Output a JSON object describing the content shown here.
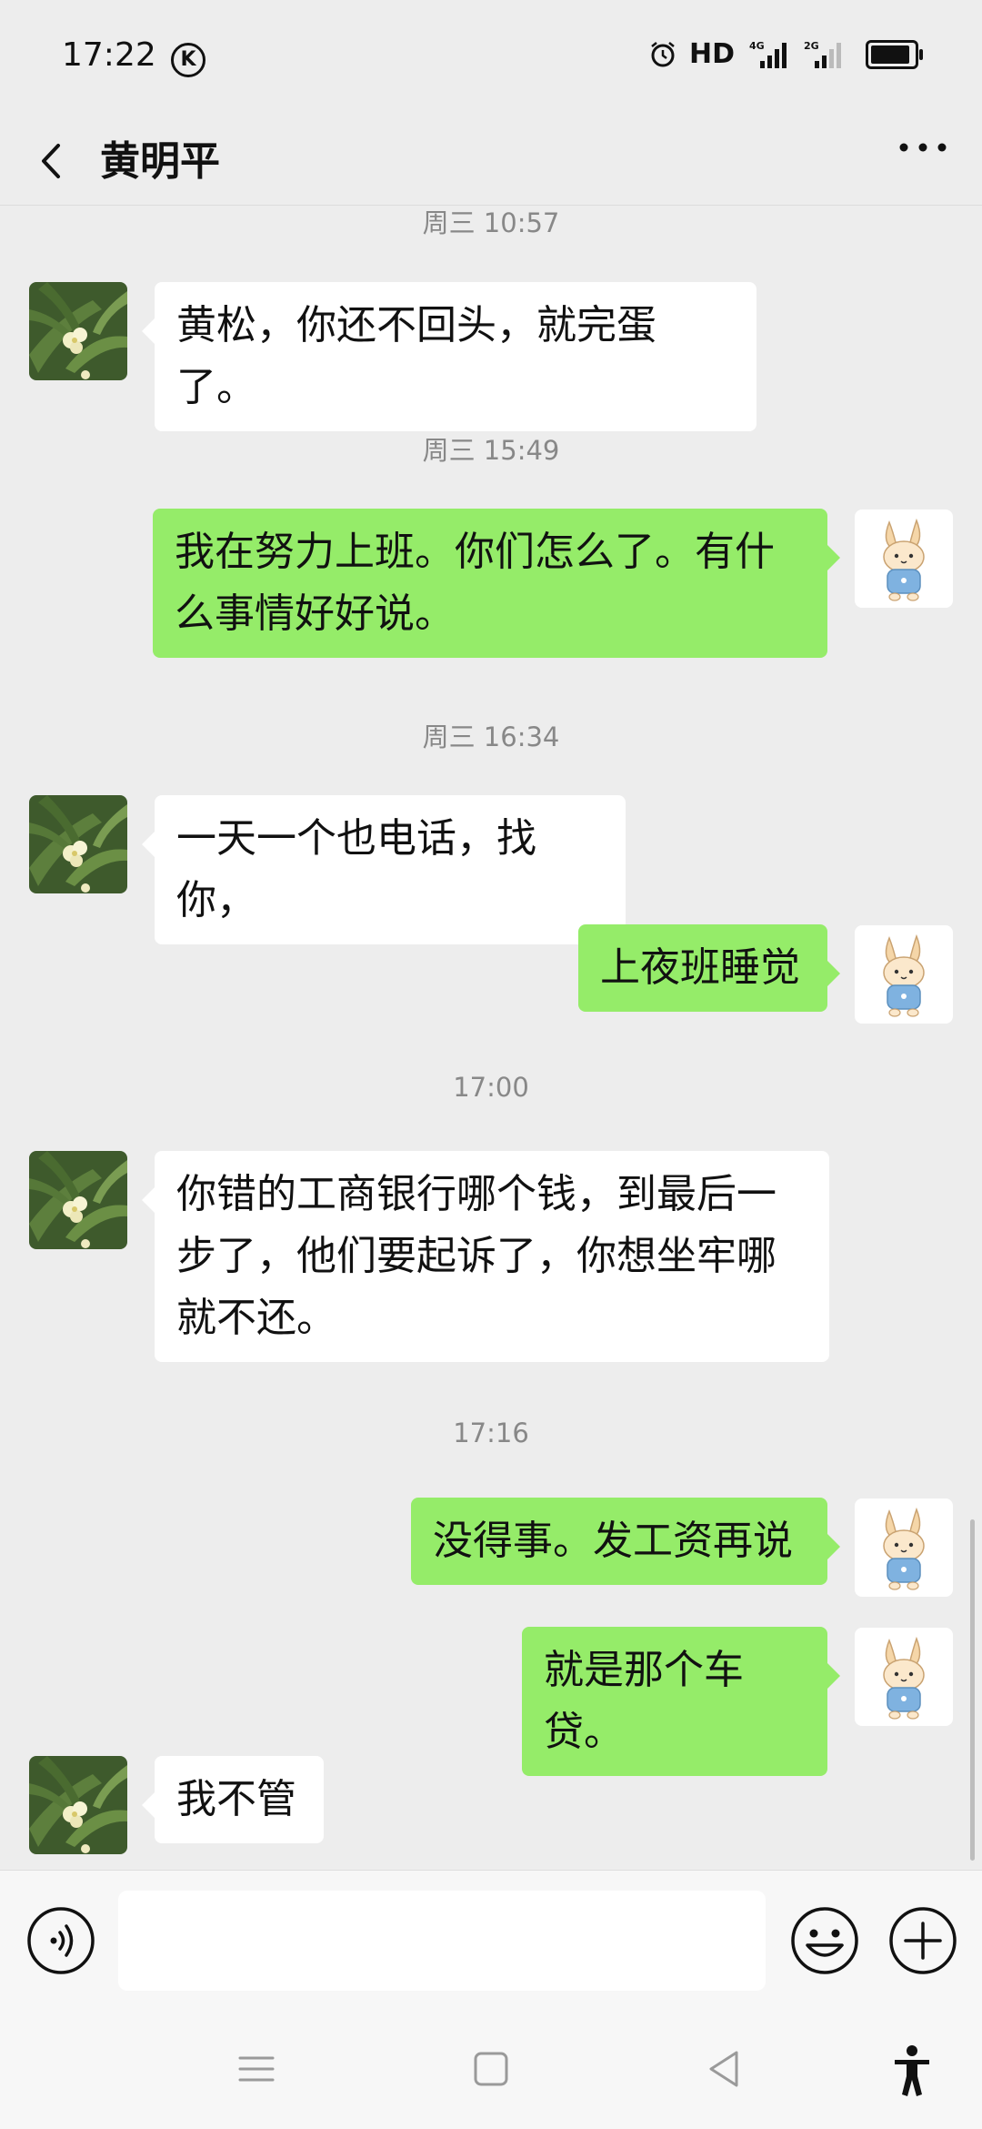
{
  "status_bar": {
    "time": "17:22",
    "k_badge": "K",
    "hd": "HD",
    "net1": "4G",
    "net2": "2G"
  },
  "header": {
    "title": "黄明平",
    "back_icon": "chevron-left-icon",
    "more_icon": "more-dots-icon"
  },
  "chat": {
    "timestamps": [
      "周三 10:57",
      "周三 15:49",
      "周三 16:34",
      "17:00",
      "17:16"
    ],
    "messages": [
      {
        "side": "in",
        "text": "黄松，你还不回头，就完蛋了。"
      },
      {
        "side": "out",
        "text": "我在努力上班。你们怎么了。有什么事情好好说。"
      },
      {
        "side": "in",
        "text": "一天一个也电话，找你，"
      },
      {
        "side": "out",
        "text": "上夜班睡觉"
      },
      {
        "side": "in",
        "text": "你错的工商银行哪个钱，到最后一步了，他们要起诉了，你想坐牢哪就不还。"
      },
      {
        "side": "out",
        "text": "没得事。发工资再说"
      },
      {
        "side": "out",
        "text": "就是那个车贷。"
      },
      {
        "side": "in",
        "text": "我不管"
      }
    ]
  },
  "input_bar": {
    "value": "",
    "voice_icon": "voice-icon",
    "emoji_icon": "emoji-icon",
    "plus_icon": "plus-icon"
  },
  "colors": {
    "background": "#ededed",
    "outgoing_bubble": "#95ec69",
    "incoming_bubble": "#ffffff",
    "timestamp": "#888888"
  }
}
